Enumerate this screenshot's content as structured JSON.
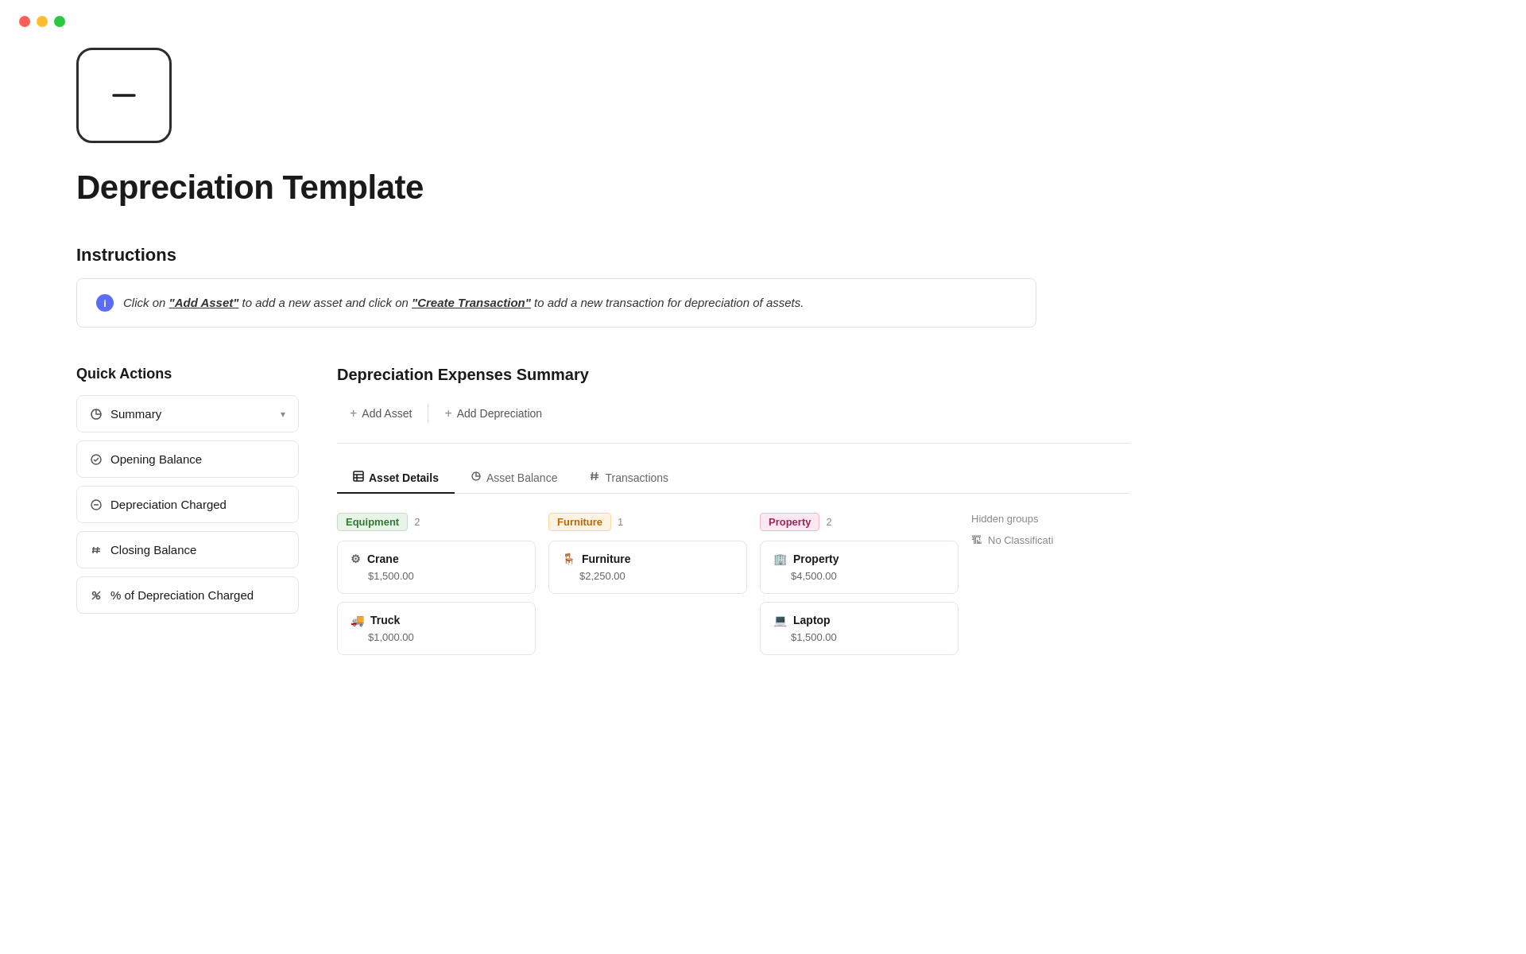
{
  "traffic_lights": {
    "red": "#ff5f57",
    "yellow": "#ffbd2e",
    "green": "#28c840"
  },
  "app_icon": {
    "aria": "depreciation-app-icon"
  },
  "page_title": "Depreciation Template",
  "instructions": {
    "heading": "Instructions",
    "info_icon": "i",
    "text_prefix": "Click on ",
    "add_asset_link": "\"Add Asset\"",
    "text_middle": " to add a new asset and click on ",
    "create_transaction_link": "\"Create Transaction\"",
    "text_suffix": " to add a new transaction for depreciation of assets."
  },
  "sidebar": {
    "heading": "Quick Actions",
    "items": [
      {
        "icon": "pie",
        "label": "Summary",
        "has_chevron": true
      },
      {
        "icon": "check-circle",
        "label": "Opening Balance",
        "has_chevron": false
      },
      {
        "icon": "minus-circle",
        "label": "Depreciation Charged",
        "has_chevron": false
      },
      {
        "icon": "hash",
        "label": "Closing Balance",
        "has_chevron": false
      },
      {
        "icon": "percent",
        "label": "% of Depreciation Charged",
        "has_chevron": false
      }
    ]
  },
  "main_panel": {
    "heading": "Depreciation Expenses Summary",
    "add_asset_label": "Add Asset",
    "add_depreciation_label": "Add Depreciation",
    "tabs": [
      {
        "label": "Asset Details",
        "icon": "table",
        "active": true
      },
      {
        "label": "Asset Balance",
        "icon": "pie-small",
        "active": false
      },
      {
        "label": "Transactions",
        "icon": "hash-small",
        "active": false
      }
    ],
    "groups": [
      {
        "badge_label": "Equipment",
        "badge_class": "badge-equipment",
        "count": "2",
        "assets": [
          {
            "icon": "crane",
            "name": "Crane",
            "value": "$1,500.00"
          },
          {
            "icon": "truck",
            "name": "Truck",
            "value": "$1,000.00"
          }
        ]
      },
      {
        "badge_label": "Furniture",
        "badge_class": "badge-furniture",
        "count": "1",
        "assets": [
          {
            "icon": "furniture",
            "name": "Furniture",
            "value": "$2,250.00"
          }
        ]
      },
      {
        "badge_label": "Property",
        "badge_class": "badge-property",
        "count": "2",
        "assets": [
          {
            "icon": "building",
            "name": "Property",
            "value": "$4,500.00"
          },
          {
            "icon": "laptop",
            "name": "Laptop",
            "value": "$1,500.00"
          }
        ]
      }
    ],
    "hidden_groups": {
      "title": "Hidden groups",
      "item_label": "No Classificati"
    }
  }
}
